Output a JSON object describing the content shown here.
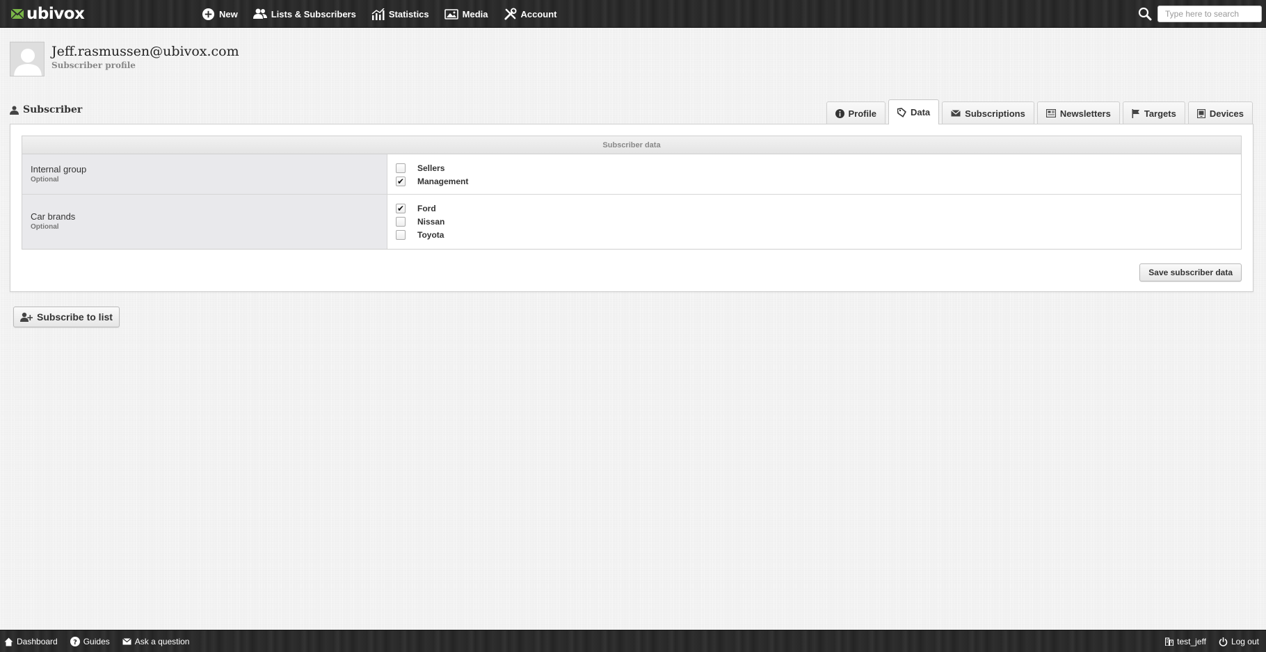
{
  "app": {
    "logo_text": "ubivox"
  },
  "nav": {
    "items": [
      {
        "label": "New",
        "icon": "plus-circle-icon"
      },
      {
        "label": "Lists & Subscribers",
        "icon": "users-icon"
      },
      {
        "label": "Statistics",
        "icon": "chart-icon"
      },
      {
        "label": "Media",
        "icon": "image-icon"
      },
      {
        "label": "Account",
        "icon": "tools-icon"
      }
    ]
  },
  "search": {
    "placeholder": "Type here to search"
  },
  "header": {
    "title": "Jeff.rasmussen@ubivox.com",
    "subtitle": "Subscriber profile"
  },
  "section": {
    "title": "Subscriber"
  },
  "tabs": [
    {
      "label": "Profile",
      "icon": "info-icon",
      "active": false
    },
    {
      "label": "Data",
      "icon": "tag-icon",
      "active": true
    },
    {
      "label": "Subscriptions",
      "icon": "envelope-icon",
      "active": false
    },
    {
      "label": "Newsletters",
      "icon": "newspaper-icon",
      "active": false
    },
    {
      "label": "Targets",
      "icon": "flag-icon",
      "active": false
    },
    {
      "label": "Devices",
      "icon": "device-icon",
      "active": false
    }
  ],
  "data_table": {
    "header": "Subscriber data",
    "rows": [
      {
        "label": "Internal group",
        "hint": "Optional",
        "options": [
          {
            "label": "Sellers",
            "checked": false
          },
          {
            "label": "Management",
            "checked": true
          }
        ]
      },
      {
        "label": "Car brands",
        "hint": "Optional",
        "options": [
          {
            "label": "Ford",
            "checked": true
          },
          {
            "label": "Nissan",
            "checked": false
          },
          {
            "label": "Toyota",
            "checked": false
          }
        ]
      }
    ]
  },
  "buttons": {
    "save": "Save subscriber data",
    "subscribe": "Subscribe to list"
  },
  "footer": {
    "left": [
      {
        "label": "Dashboard",
        "icon": "home-icon"
      },
      {
        "label": "Guides",
        "icon": "help-icon"
      },
      {
        "label": "Ask a question",
        "icon": "mail-icon"
      }
    ],
    "right": [
      {
        "label": "test_jeff",
        "icon": "building-icon"
      },
      {
        "label": "Log out",
        "icon": "power-icon"
      }
    ]
  },
  "colors": {
    "brand_green": "#7ab648",
    "topbar": "#2b2b2b"
  }
}
